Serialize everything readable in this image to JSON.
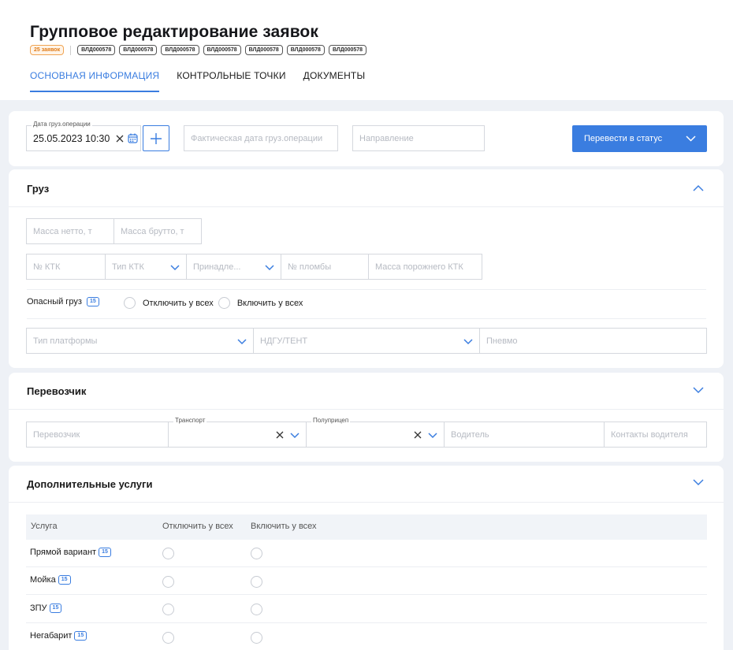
{
  "header": {
    "title": "Групповое редактирование заявок",
    "count_tag": "25 заявок",
    "id_tags": [
      "ВЛД000578",
      "ВЛД000578",
      "ВЛД000578",
      "ВЛД000578",
      "ВЛД000578",
      "ВЛД000578",
      "ВЛД000578"
    ],
    "tabs": [
      "ОСНОВНАЯ ИНФОРМАЦИЯ",
      "КОНТРОЛЬНЫЕ ТОЧКИ",
      "ДОКУМЕНТЫ"
    ],
    "active_tab": 0
  },
  "top_bar": {
    "date_legend": "Дата груз.операции",
    "date_value": "25.05.2023 10:30",
    "actual_date_placeholder": "Фактическая дата груз.операции",
    "direction_placeholder": "Направление",
    "status_button": "Перевести в статус"
  },
  "cargo": {
    "title": "Груз",
    "net_mass_placeholder": "Масса нетто, т",
    "gross_mass_placeholder": "Масса брутто, т",
    "ktk_number_placeholder": "№ КТК",
    "ktk_type_placeholder": "Тип КТК",
    "ownership_placeholder": "Принадле...",
    "seal_placeholder": "№ пломбы",
    "empty_mass_placeholder": "Масса порожнего КТК",
    "dangerous_label": "Опасный груз",
    "dangerous_count": "15",
    "disable_all": "Отключить у всех",
    "enable_all": "Включить у всех",
    "platform_type_placeholder": "Тип платформы",
    "ndgu_placeholder": "НДГУ/ТЕНТ",
    "pneumo_placeholder": "Пневмо"
  },
  "carrier": {
    "title": "Перевозчик",
    "carrier_placeholder": "Перевозчик",
    "transport_legend": "Транспорт",
    "trailer_legend": "Полуприцеп",
    "driver_placeholder": "Водитель",
    "driver_contacts_placeholder": "Контакты водителя"
  },
  "services": {
    "title": "Дополнительные услуги",
    "col_service": "Услуга",
    "col_disable": "Отключить у всех",
    "col_enable": "Включить у всех",
    "rows": [
      {
        "name": "Прямой вариант",
        "count": "15"
      },
      {
        "name": "Мойка",
        "count": "15"
      },
      {
        "name": "ЗПУ",
        "count": "15"
      },
      {
        "name": "Негабарит",
        "count": "15"
      }
    ]
  },
  "colors": {
    "accent": "#3a7de0",
    "warning": "#e07b17",
    "background": "#eef1f6"
  }
}
